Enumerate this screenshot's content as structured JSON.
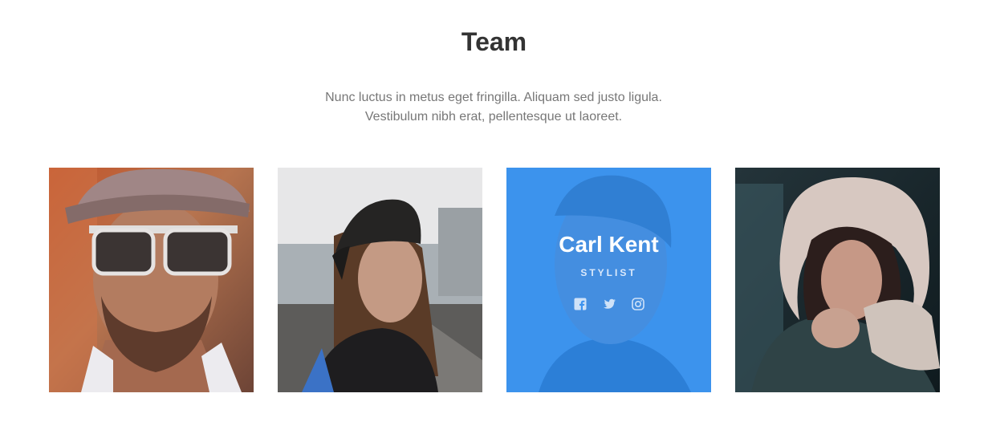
{
  "header": {
    "title": "Team",
    "description_lines": [
      "Nunc luctus in metus eget fringilla. Aliquam sed justo ligula.",
      "Vestibulum nibh erat, pellentesque ut laoreet."
    ]
  },
  "team": {
    "featured": {
      "name": "Carl Kent",
      "role": "STYLIST",
      "social_icons": [
        "facebook-icon",
        "twitter-icon",
        "instagram-icon"
      ]
    }
  },
  "colors": {
    "overlay": "#2e8df0",
    "title": "#333333",
    "text": "#777777"
  }
}
